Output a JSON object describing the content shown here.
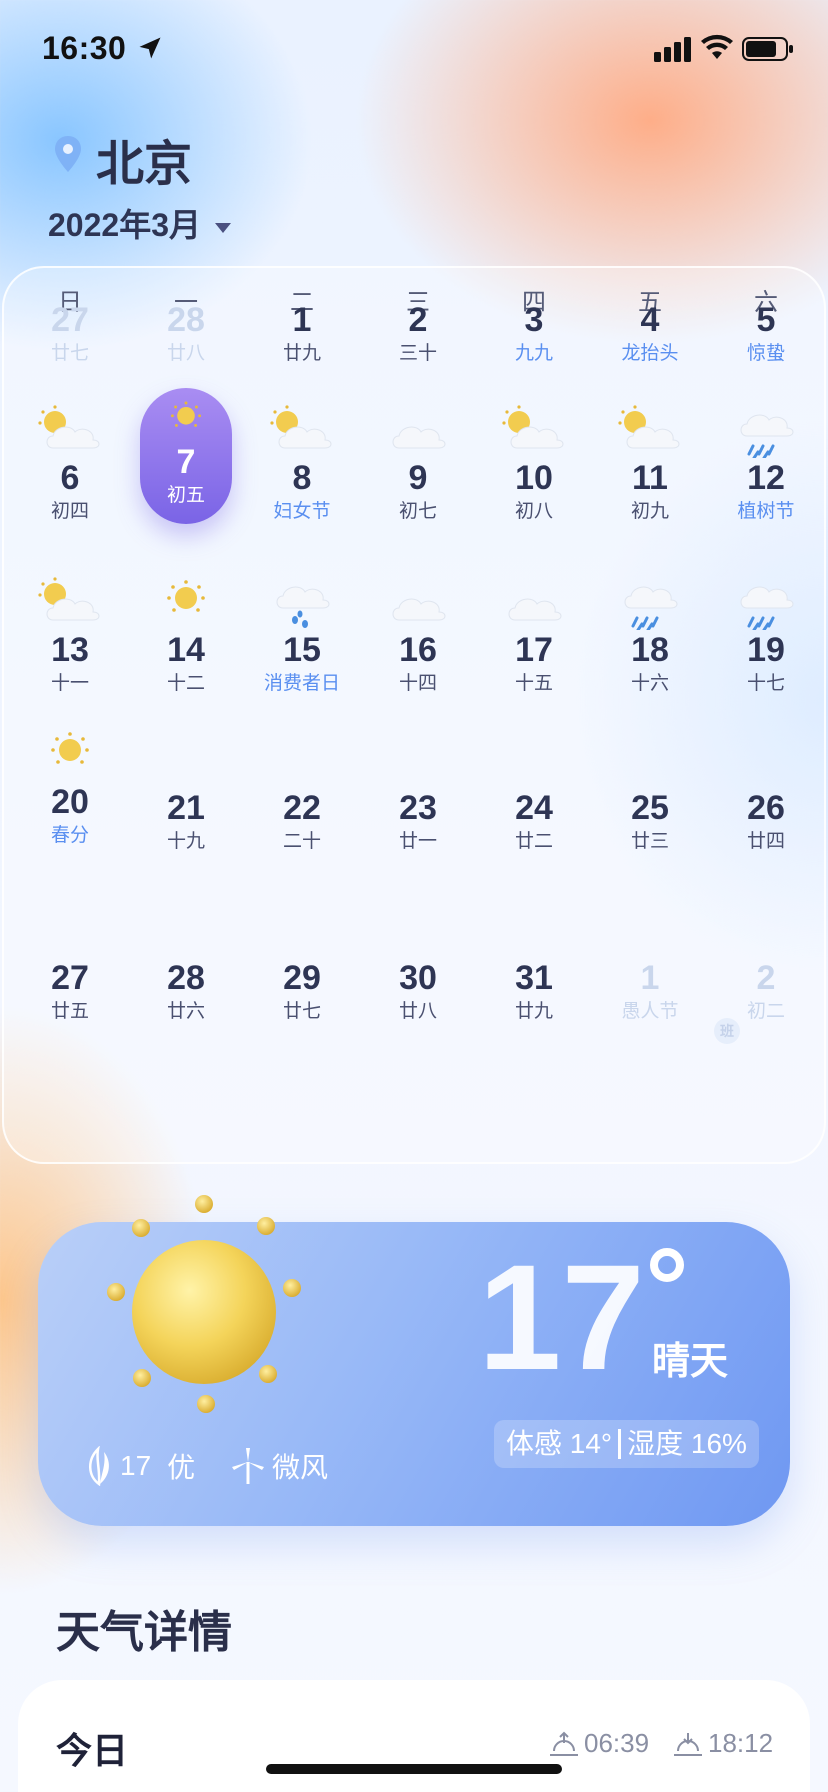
{
  "status_bar": {
    "time": "16:30"
  },
  "header": {
    "city": "北京",
    "month": "2022年3月"
  },
  "calendar": {
    "weekdays": [
      "日",
      "一",
      "二",
      "三",
      "四",
      "五",
      "六"
    ],
    "weeks": [
      [
        {
          "day": "27",
          "sub": "廿七",
          "muted": true
        },
        {
          "day": "28",
          "sub": "廿八",
          "muted": true
        },
        {
          "day": "1",
          "sub": "廿九"
        },
        {
          "day": "2",
          "sub": "三十"
        },
        {
          "day": "3",
          "sub": "九九",
          "festival": true
        },
        {
          "day": "4",
          "sub": "龙抬头",
          "festival": true
        },
        {
          "day": "5",
          "sub": "惊蛰",
          "festival": true
        }
      ],
      [
        {
          "day": "6",
          "sub": "初四",
          "icon": "partly-cloudy-icon"
        },
        {
          "day": "7",
          "sub": "初五",
          "icon": "sun-icon",
          "selected": true
        },
        {
          "day": "8",
          "sub": "妇女节",
          "icon": "partly-cloudy-icon",
          "festival": true
        },
        {
          "day": "9",
          "sub": "初七",
          "icon": "cloud-icon"
        },
        {
          "day": "10",
          "sub": "初八",
          "icon": "partly-cloudy-icon"
        },
        {
          "day": "11",
          "sub": "初九",
          "icon": "partly-cloudy-icon"
        },
        {
          "day": "12",
          "sub": "植树节",
          "icon": "rain-icon",
          "festival": true
        }
      ],
      [
        {
          "day": "13",
          "sub": "十一",
          "icon": "partly-cloudy-icon"
        },
        {
          "day": "14",
          "sub": "十二",
          "icon": "sun-icon"
        },
        {
          "day": "15",
          "sub": "消费者日",
          "icon": "light-rain-icon",
          "festival": true
        },
        {
          "day": "16",
          "sub": "十四",
          "icon": "cloud-icon"
        },
        {
          "day": "17",
          "sub": "十五",
          "icon": "cloud-icon"
        },
        {
          "day": "18",
          "sub": "十六",
          "icon": "rain-icon"
        },
        {
          "day": "19",
          "sub": "十七",
          "icon": "rain-icon"
        }
      ],
      [
        {
          "day": "20",
          "sub": "春分",
          "icon": "sun-icon",
          "festival": true
        },
        {
          "day": "21",
          "sub": "十九"
        },
        {
          "day": "22",
          "sub": "二十"
        },
        {
          "day": "23",
          "sub": "廿一"
        },
        {
          "day": "24",
          "sub": "廿二"
        },
        {
          "day": "25",
          "sub": "廿三"
        },
        {
          "day": "26",
          "sub": "廿四"
        }
      ],
      [
        {
          "day": "27",
          "sub": "廿五"
        },
        {
          "day": "28",
          "sub": "廿六"
        },
        {
          "day": "29",
          "sub": "廿七"
        },
        {
          "day": "30",
          "sub": "廿八"
        },
        {
          "day": "31",
          "sub": "廿九"
        },
        {
          "day": "1",
          "sub": "愚人节",
          "muted": true
        },
        {
          "day": "2",
          "sub": "初二",
          "muted": true
        }
      ]
    ],
    "holiday_badge": "班"
  },
  "weather": {
    "temperature": "17",
    "condition": "晴天",
    "feels_like": "体感 14°",
    "humidity": "湿度 16%",
    "aqi_value": "17",
    "aqi_level": "优",
    "wind": "微风",
    "icon": "sun-icon"
  },
  "details": {
    "title": "天气详情",
    "today_label": "今日",
    "sunrise": "06:39",
    "sunset": "18:12"
  },
  "colors": {
    "selected_day": "#7a64e6",
    "festival_text": "#5a8ff0",
    "weather_card": "#6f98f2"
  }
}
